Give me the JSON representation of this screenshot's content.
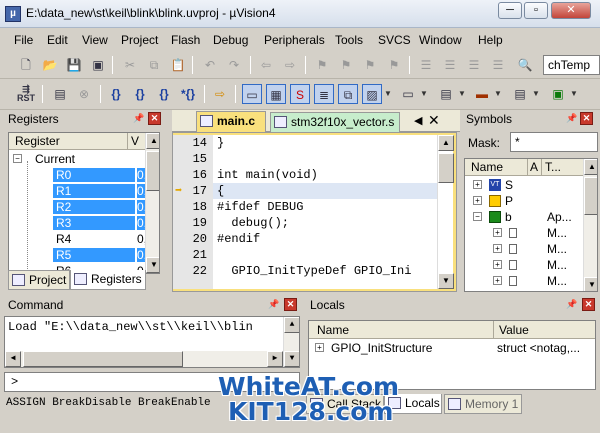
{
  "window": {
    "title": "E:\\data_new\\st\\keil\\blink\\blink.uvproj - µVision4",
    "minimize": "─",
    "maximize": "▫",
    "close": "✕"
  },
  "menu": [
    "File",
    "Edit",
    "View",
    "Project",
    "Flash",
    "Debug",
    "Peripherals",
    "Tools",
    "SVCS",
    "Window",
    "Help"
  ],
  "toolbar1": {
    "find_text": "chTemp"
  },
  "registers": {
    "title": "Registers",
    "col_register": "Register",
    "col_value": "V",
    "group": "Current",
    "rows": [
      {
        "name": "R0",
        "value": "0,",
        "selected": true
      },
      {
        "name": "R1",
        "value": "0,",
        "selected": true
      },
      {
        "name": "R2",
        "value": "0,",
        "selected": true
      },
      {
        "name": "R3",
        "value": "0,",
        "selected": true
      },
      {
        "name": "R4",
        "value": "0,",
        "selected": false
      },
      {
        "name": "R5",
        "value": "0,",
        "selected": true
      },
      {
        "name": "R6",
        "value": "0,",
        "selected": false
      }
    ],
    "tab_project": "Project",
    "tab_registers": "Registers"
  },
  "editor": {
    "tabs": [
      {
        "label": "main.c",
        "active": true
      },
      {
        "label": "stm32f10x_vector.s",
        "active": false
      }
    ],
    "lines": [
      {
        "n": "14",
        "text": "}"
      },
      {
        "n": "15",
        "text": ""
      },
      {
        "n": "16",
        "text": "int main(void)"
      },
      {
        "n": "17",
        "text": "{"
      },
      {
        "n": "18",
        "text": "#ifdef DEBUG"
      },
      {
        "n": "19",
        "text": "  debug();"
      },
      {
        "n": "20",
        "text": "#endif"
      },
      {
        "n": "21",
        "text": ""
      },
      {
        "n": "22",
        "text": "  GPIO_InitTypeDef GPIO_Ini"
      }
    ]
  },
  "symbols": {
    "title": "Symbols",
    "mask_label": "Mask:",
    "mask_value": "*",
    "col_name": "Name",
    "col_a": "A",
    "col_type": "T...",
    "rows": [
      {
        "name": "S",
        "type": ""
      },
      {
        "name": "P",
        "type": ""
      },
      {
        "name": "b",
        "type": "Ap..."
      },
      {
        "name": "",
        "type": "M..."
      },
      {
        "name": "",
        "type": "M..."
      },
      {
        "name": "",
        "type": "M..."
      },
      {
        "name": "",
        "type": "M..."
      }
    ]
  },
  "command": {
    "title": "Command",
    "output": "Load \"E:\\\\data_new\\\\st\\\\keil\\\\blin",
    "prompt": ">",
    "status": "ASSIGN BreakDisable BreakEnable"
  },
  "locals": {
    "title": "Locals",
    "col_name": "Name",
    "col_value": "Value",
    "rows": [
      {
        "name": "GPIO_InitStructure",
        "value": "struct <notag,..."
      }
    ],
    "tabs": [
      {
        "label": "Call Stack"
      },
      {
        "label": "Locals"
      },
      {
        "label": "Memory 1"
      }
    ]
  },
  "watermark": {
    "line1": "WhiteAT.com",
    "line2": "KIT128.com"
  },
  "colors": {
    "selection": "#3399ff",
    "current_line": "#dde6f4",
    "watermark": "#1e5fb4"
  }
}
